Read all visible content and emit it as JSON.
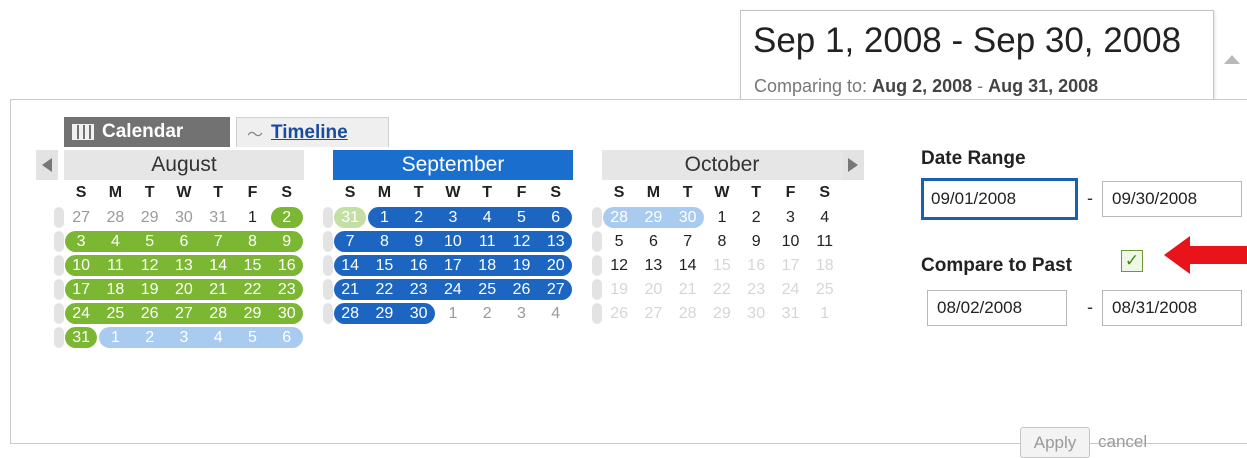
{
  "summary": {
    "range": "Sep 1, 2008 - Sep 30, 2008",
    "compare_prefix": "Comparing to:",
    "compare_start": "Aug 2, 2008",
    "compare_sep": " - ",
    "compare_end": "Aug 31, 2008"
  },
  "tabs": {
    "calendar": "Calendar",
    "timeline": "Timeline"
  },
  "months": [
    {
      "name": "August",
      "weekdays": [
        "S",
        "M",
        "T",
        "W",
        "T",
        "F",
        "S"
      ],
      "weeks": [
        [
          "27",
          "28",
          "29",
          "30",
          "31",
          "1",
          "2"
        ],
        [
          "3",
          "4",
          "5",
          "6",
          "7",
          "8",
          "9"
        ],
        [
          "10",
          "11",
          "12",
          "13",
          "14",
          "15",
          "16"
        ],
        [
          "17",
          "18",
          "19",
          "20",
          "21",
          "22",
          "23"
        ],
        [
          "24",
          "25",
          "26",
          "27",
          "28",
          "29",
          "30"
        ],
        [
          "31",
          "1",
          "2",
          "3",
          "4",
          "5",
          "6"
        ]
      ]
    },
    {
      "name": "September",
      "weekdays": [
        "S",
        "M",
        "T",
        "W",
        "T",
        "F",
        "S"
      ],
      "weeks": [
        [
          "31",
          "1",
          "2",
          "3",
          "4",
          "5",
          "6"
        ],
        [
          "7",
          "8",
          "9",
          "10",
          "11",
          "12",
          "13"
        ],
        [
          "14",
          "15",
          "16",
          "17",
          "18",
          "19",
          "20"
        ],
        [
          "21",
          "22",
          "23",
          "24",
          "25",
          "26",
          "27"
        ],
        [
          "28",
          "29",
          "30",
          "1",
          "2",
          "3",
          "4"
        ]
      ]
    },
    {
      "name": "October",
      "weekdays": [
        "S",
        "M",
        "T",
        "W",
        "T",
        "F",
        "S"
      ],
      "weeks": [
        [
          "28",
          "29",
          "30",
          "1",
          "2",
          "3",
          "4"
        ],
        [
          "5",
          "6",
          "7",
          "8",
          "9",
          "10",
          "11"
        ],
        [
          "12",
          "13",
          "14",
          "15",
          "16",
          "17",
          "18"
        ],
        [
          "19",
          "20",
          "21",
          "22",
          "23",
          "24",
          "25"
        ],
        [
          "26",
          "27",
          "28",
          "29",
          "30",
          "31",
          "1"
        ]
      ]
    }
  ],
  "date_range": {
    "label": "Date Range",
    "start": "09/01/2008",
    "separator": "-",
    "end": "09/30/2008"
  },
  "compare": {
    "label": "Compare to Past",
    "checked": true,
    "start": "08/02/2008",
    "separator": "-",
    "end": "08/31/2008"
  },
  "actions": {
    "apply": "Apply",
    "cancel": "cancel"
  },
  "colors": {
    "selected": "#1c65c0",
    "compare": "#7cb733",
    "light_blue": "#a9cbf0",
    "arrow": "#e8141a"
  },
  "icons": [
    "calendar-grid-icon",
    "timeline-icon",
    "chevron-left-icon",
    "chevron-right-icon",
    "check-icon",
    "red-arrow-icon",
    "collapse-up-icon"
  ]
}
